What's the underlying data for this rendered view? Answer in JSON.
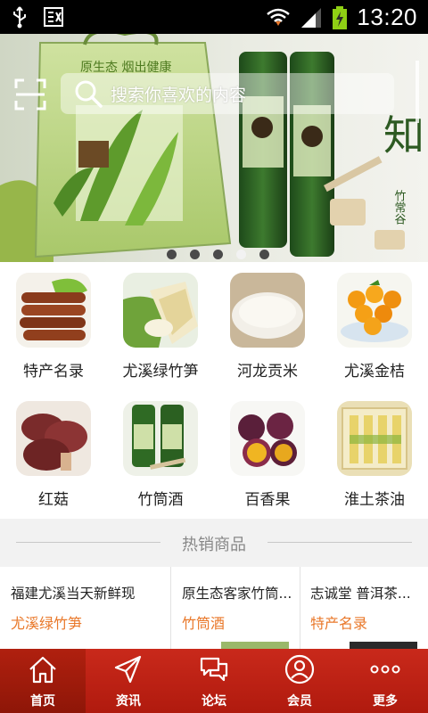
{
  "status_bar": {
    "time": "13:20",
    "icons": [
      "usb-icon",
      "debug-icon",
      "wifi-icon",
      "signal-icon",
      "battery-charging-icon"
    ]
  },
  "search": {
    "placeholder": "搜索你喜欢的内容"
  },
  "banner": {
    "slide_count": 5,
    "active_slide": 4,
    "bag_text": "原生态    烟出健康"
  },
  "categories": [
    {
      "label": "特产名录"
    },
    {
      "label": "尤溪绿竹笋"
    },
    {
      "label": "河龙贡米"
    },
    {
      "label": "尤溪金桔"
    },
    {
      "label": "红菇"
    },
    {
      "label": "竹筒酒"
    },
    {
      "label": "百香果"
    },
    {
      "label": "淮土茶油"
    }
  ],
  "hot_section": {
    "title": "热销商品"
  },
  "products": [
    {
      "title": "福建尤溪当天新鲜现...",
      "category": "尤溪绿竹笋"
    },
    {
      "title": "原生态客家竹筒...",
      "category": "竹筒酒"
    },
    {
      "title": "志诚堂 普洱茶...",
      "category": "特产名录"
    }
  ],
  "tabs": [
    {
      "label": "首页",
      "icon": "home-icon",
      "active": true
    },
    {
      "label": "资讯",
      "icon": "paper-plane-icon",
      "active": false
    },
    {
      "label": "论坛",
      "icon": "chat-bubbles-icon",
      "active": false
    },
    {
      "label": "会员",
      "icon": "user-icon",
      "active": false
    },
    {
      "label": "更多",
      "icon": "more-dots-icon",
      "active": false
    }
  ],
  "colors": {
    "tab_bar": "#c9291b",
    "category_accent": "#e9782a"
  }
}
